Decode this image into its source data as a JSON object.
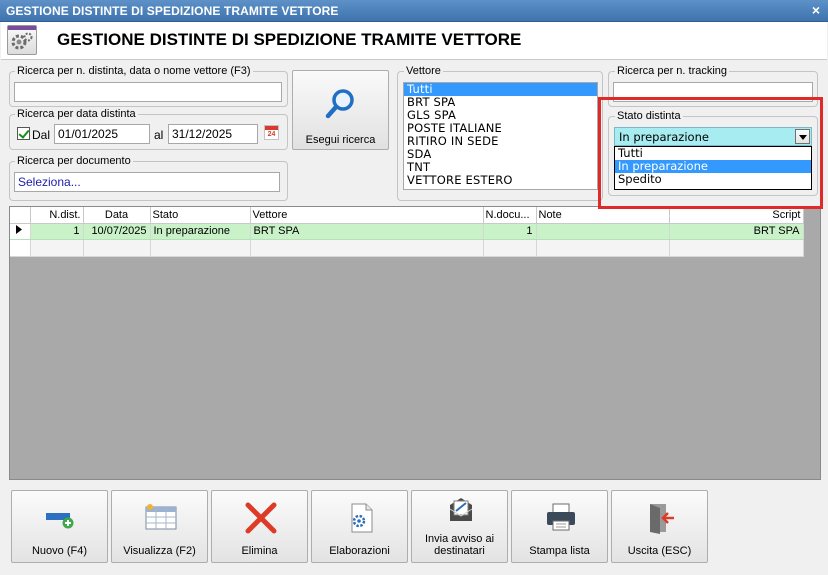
{
  "window": {
    "title": "GESTIONE DISTINTE DI SPEDIZIONE TRAMITE VETTORE",
    "close": "×"
  },
  "header": {
    "title": "GESTIONE DISTINTE DI SPEDIZIONE TRAMITE VETTORE"
  },
  "search_number": {
    "label": "Ricerca per n. distinta, data o nome vettore (F3)",
    "value": ""
  },
  "search_date": {
    "label": "Ricerca per data distinta",
    "from_label": "Dal",
    "from_value": "01/01/2025",
    "to_label": "al",
    "to_value": "31/12/2025",
    "calendar_text": "24",
    "checked": true
  },
  "search_document": {
    "label": "Ricerca per documento",
    "value": "Seleziona..."
  },
  "search_button": {
    "label": "Esegui ricerca"
  },
  "vettore": {
    "label": "Vettore",
    "items": [
      "Tutti",
      "BRT SPA",
      "GLS SPA",
      "POSTE ITALIANE",
      "RITIRO IN SEDE",
      "SDA",
      "TNT",
      "VETTORE ESTERO"
    ],
    "selected": "Tutti"
  },
  "tracking": {
    "label": "Ricerca per n. tracking",
    "value": ""
  },
  "stato": {
    "label": "Stato distinta",
    "value": "In preparazione",
    "options": [
      "Tutti",
      "In preparazione",
      "Spedito"
    ]
  },
  "grid": {
    "columns": [
      "N.dist.",
      "Data",
      "Stato",
      "Vettore",
      "N.docu...",
      "Note",
      "Script"
    ],
    "rows": [
      {
        "ndist": "1",
        "data": "10/07/2025",
        "stato": "In preparazione",
        "vettore": "BRT SPA",
        "ndoc": "1",
        "note": "",
        "script": "BRT SPA"
      }
    ]
  },
  "buttons": {
    "nuovo": "Nuovo (F4)",
    "visualizza": "Visualizza (F2)",
    "elimina": "Elimina",
    "elaborazioni": "Elaborazioni",
    "invia_line1": "Invia avviso ai",
    "invia_line2": "destinatari",
    "stampa": "Stampa lista",
    "uscita": "Uscita (ESC)"
  },
  "colors": {
    "selection": "#3399ff",
    "row_highlight": "#c9f2c9",
    "combo_bg": "#a7ecf0",
    "callout": "#e02a2a"
  }
}
